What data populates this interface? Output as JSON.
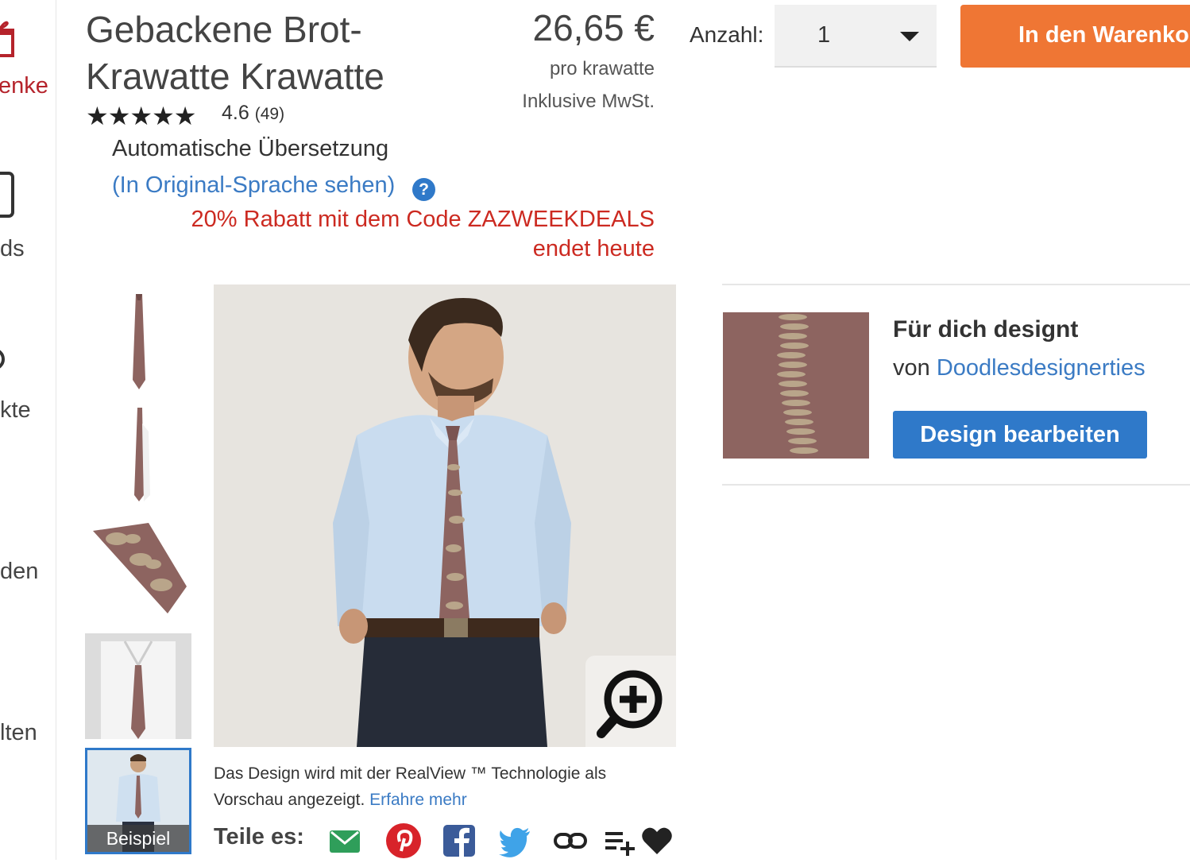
{
  "nav": {
    "items": [
      {
        "label": "enke",
        "icon": "gift-icon"
      },
      {
        "label": "ds",
        "icon": "card-icon"
      },
      {
        "label": "kte",
        "icon": "products-icon"
      },
      {
        "label": "den",
        "icon": "dots-icon"
      },
      {
        "label": "lten",
        "icon": "scan-icon"
      }
    ]
  },
  "product": {
    "title": "Gebackene Brot-Krawatte Krawatte",
    "stars": "★★★★★",
    "rating": "4.6",
    "reviews": "(49)",
    "auto_translation": "Automatische Übersetzung",
    "original_link": "(In Original-Sprache sehen)",
    "help": "?",
    "promo": "20% Rabatt mit dem Code ZAZWEEKDEALS endet heute"
  },
  "price": {
    "amount": "26,65 €",
    "per_unit": "pro krawatte",
    "vat": "Inklusive MwSt."
  },
  "quantity": {
    "label": "Anzahl:",
    "value": "1"
  },
  "cart": {
    "label": "In den Warenkorb"
  },
  "gallery": {
    "example_label": "Beispiel",
    "realview_text": "Das Design wird mit der RealView ™ Technologie als Vorschau angezeigt.",
    "realview_link": "Erfahre mehr",
    "share_label": "Teile es:"
  },
  "design": {
    "heading": "Für dich designt",
    "by": "von",
    "designer": "Doodlesdesignerties",
    "edit_button": "Design bearbeiten"
  },
  "colors": {
    "cart": "#ef7634",
    "primary": "#2f79c9",
    "promo": "#cc2a21",
    "link": "#3b7bc4",
    "tie": "#8d6460"
  }
}
